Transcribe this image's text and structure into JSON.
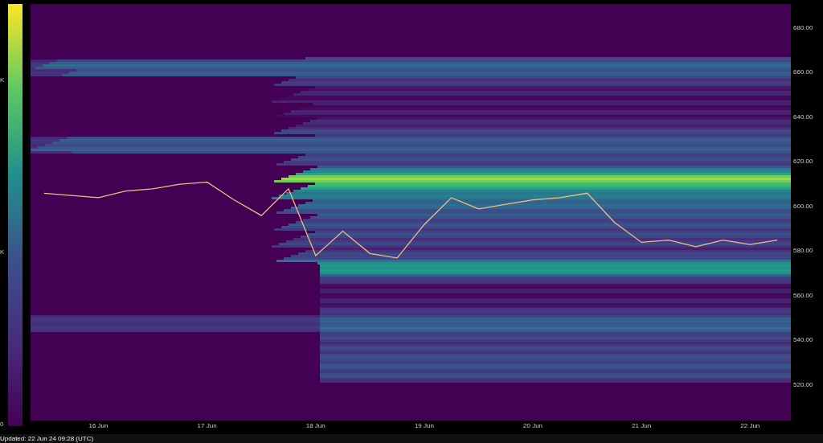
{
  "color_scale": {
    "labels": [
      "K",
      "K",
      "0"
    ]
  },
  "chart": {
    "chart_data": {
      "type": "line",
      "ylim": [
        504.14,
        690.81
      ],
      "categories": [
        null,
        null,
        "16 Jun",
        null,
        null,
        null,
        "17 Jun",
        null,
        null,
        null,
        "18 Jun",
        null,
        null,
        null,
        "19 Jun",
        null,
        null,
        null,
        "20 Jun",
        null,
        null,
        null,
        "21 Jun",
        null,
        null,
        null,
        "22 Jun",
        null
      ],
      "series": [
        {
          "color": "#f0c080",
          "values": [
            606,
            605,
            604,
            607,
            608,
            610,
            611,
            603,
            596,
            608,
            578,
            589,
            579,
            577,
            592,
            604,
            599,
            601,
            603,
            604,
            606,
            593,
            584,
            585,
            582,
            585,
            583,
            585
          ]
        }
      ],
      "yticks": [
        {
          "value": 680,
          "label": "680.00"
        },
        {
          "value": 660,
          "label": "660.00"
        },
        {
          "value": 640,
          "label": "640.00"
        },
        {
          "value": 620,
          "label": "620.00"
        },
        {
          "value": 600,
          "label": "600.00"
        },
        {
          "value": 580,
          "label": "580.00"
        },
        {
          "value": 560,
          "label": "560.00"
        },
        {
          "value": 540,
          "label": "540.00"
        },
        {
          "value": 520,
          "label": "520.00"
        }
      ]
    }
  },
  "footer": {
    "updated": "Updated: 22 Jun 24 09:28 (UTC)"
  }
}
